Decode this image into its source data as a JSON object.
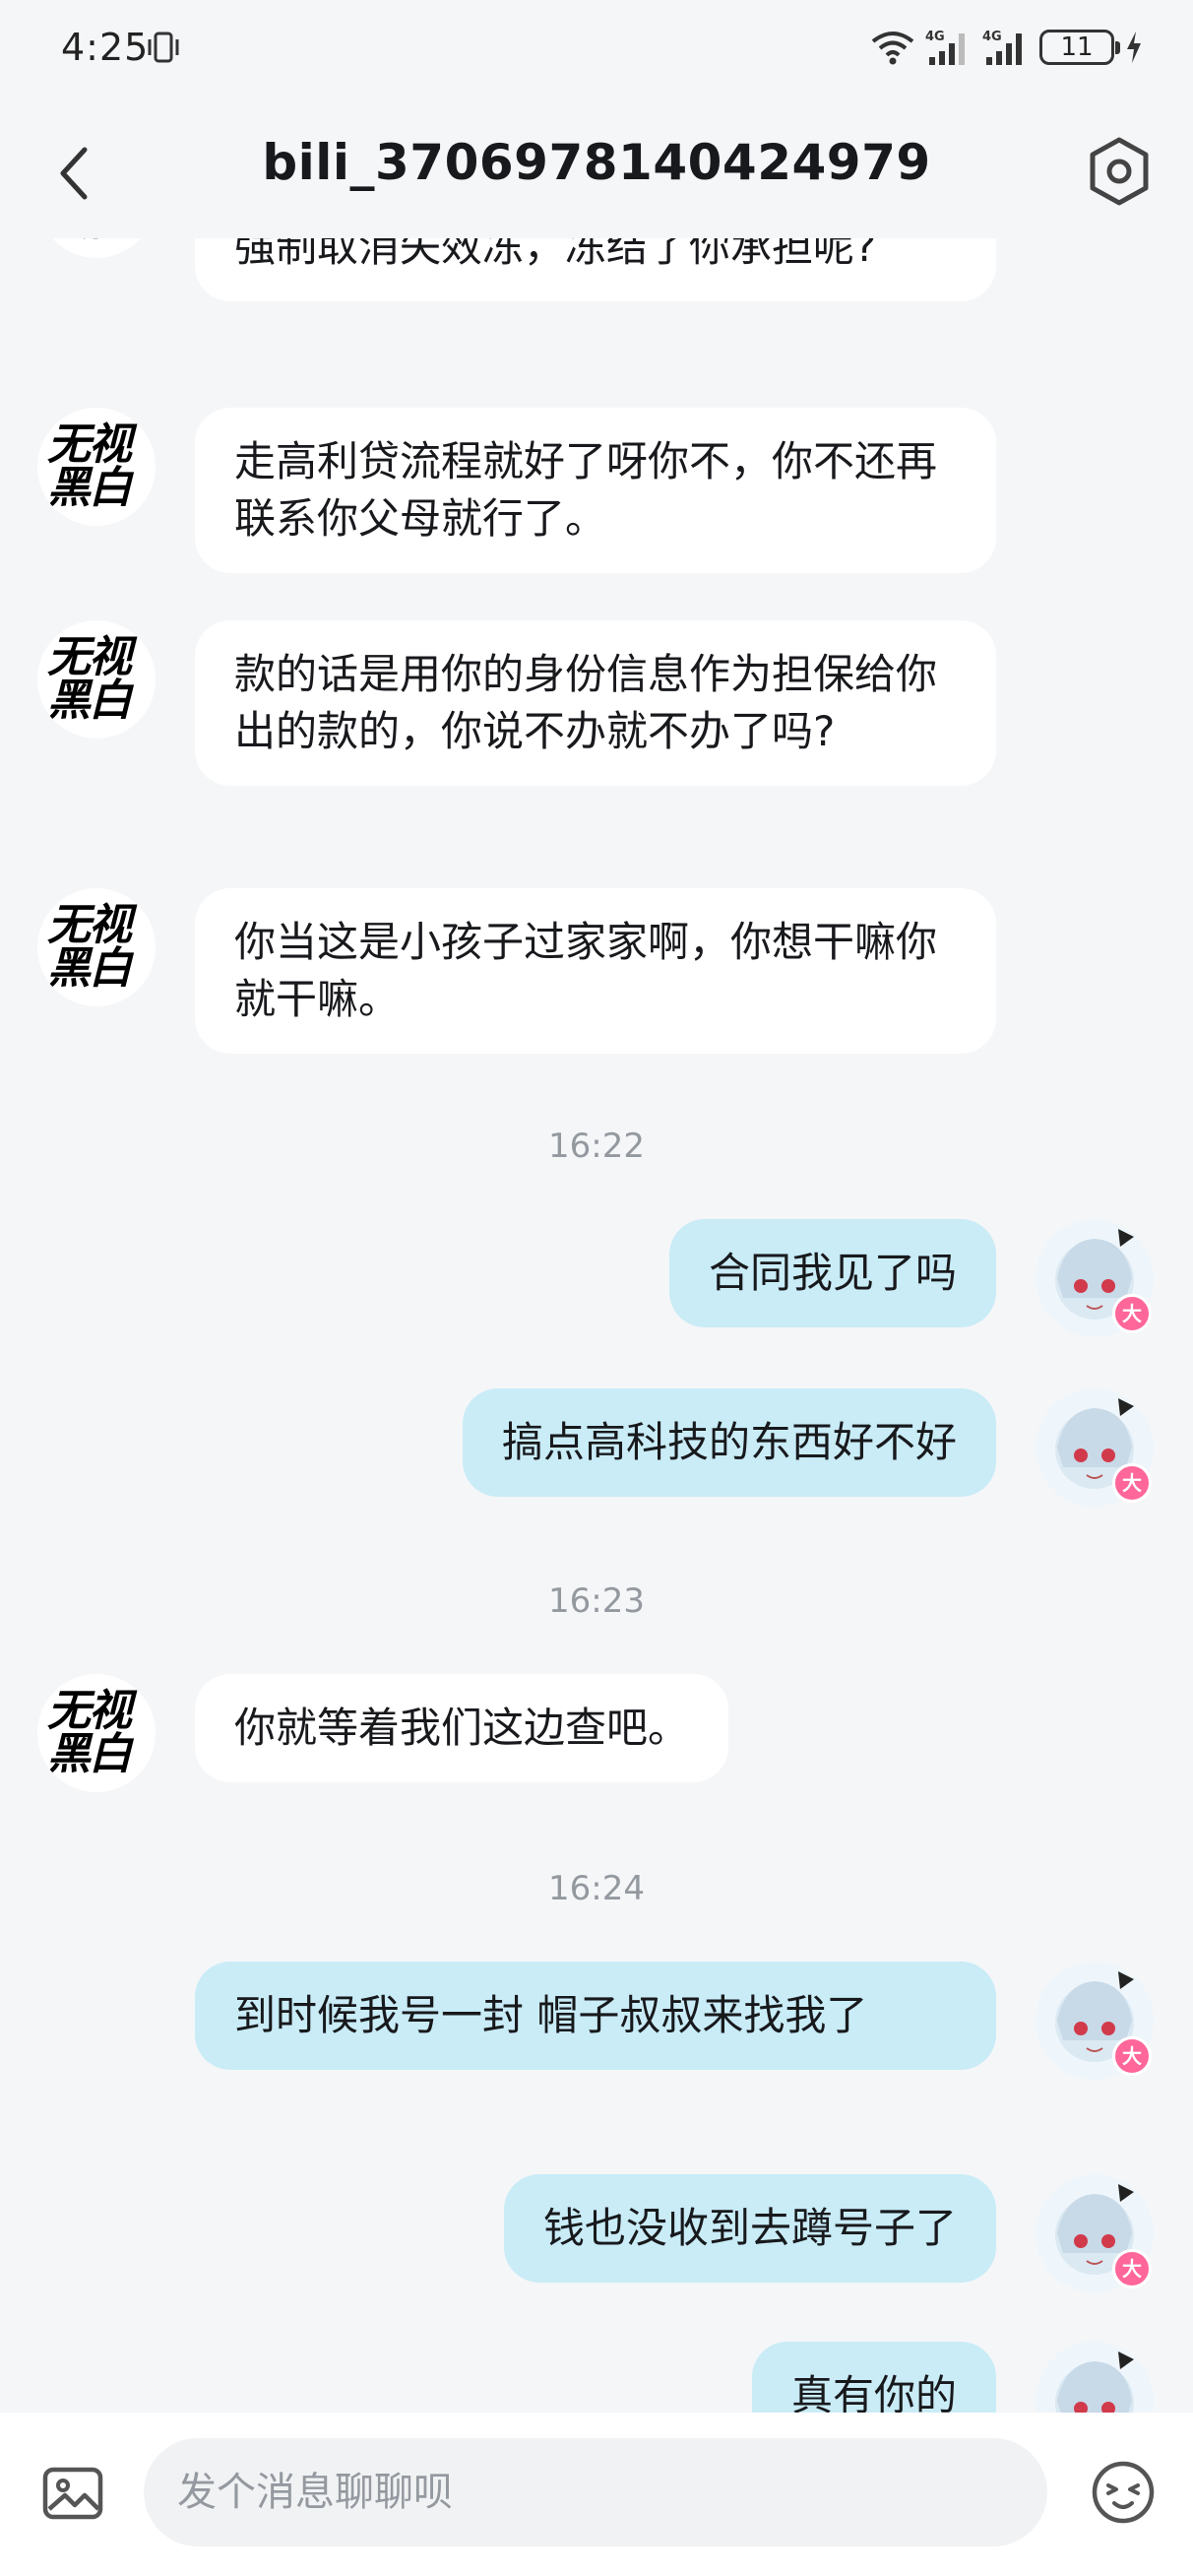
{
  "status": {
    "time": "4:25",
    "battery": "11",
    "signal_label_1": "4G",
    "signal_label_2": "4G"
  },
  "header": {
    "title": "bili_3706978140424979"
  },
  "messages": [
    {
      "side": "in",
      "text": "强制取消失效冻，冻结了你承担呢?"
    },
    {
      "side": "in",
      "text": "走高利贷流程就好了呀你不，你不还再联系你父母就行了。"
    },
    {
      "side": "in",
      "text": "款的话是用你的身份信息作为担保给你出的款的，你说不办就不办了吗?"
    },
    {
      "side": "in",
      "text": "你当这是小孩子过家家啊，你想干嘛你就干嘛。"
    },
    {
      "side": "time",
      "text": "16:22"
    },
    {
      "side": "out",
      "text": "合同我见了吗"
    },
    {
      "side": "out",
      "text": "搞点高科技的东西好不好"
    },
    {
      "side": "time",
      "text": "16:23"
    },
    {
      "side": "in",
      "text": "你就等着我们这边查吧。"
    },
    {
      "side": "time",
      "text": "16:24"
    },
    {
      "side": "out",
      "text": "到时候我号一封 帽子叔叔来找我了"
    },
    {
      "side": "out",
      "text": "钱也没收到去蹲号子了"
    },
    {
      "side": "out",
      "text": "真有你的"
    }
  ],
  "other_avatar_logo": "无视黑白",
  "self_avatar_badge": "大",
  "input": {
    "placeholder": "发个消息聊聊呗"
  },
  "icons": {
    "back": "chevron-left-icon",
    "settings": "hexagon-gear-icon",
    "image": "image-icon",
    "emoji": "emoji-icon"
  },
  "colors": {
    "bubble_in": "#ffffff",
    "bubble_out": "#c9ecf7",
    "badge": "#ff6699",
    "background": "#f5f6f8"
  }
}
